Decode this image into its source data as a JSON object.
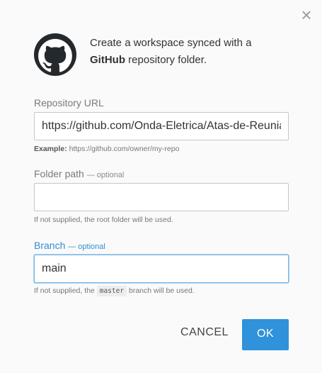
{
  "dialog": {
    "close_glyph": "×",
    "header": {
      "line1": "Create a workspace synced with a",
      "brand": "GitHub",
      "line2_rest": " repository folder.",
      "logo_icon": "github-icon"
    },
    "repo_url": {
      "label": "Repository URL",
      "value": "https://github.com/Onda-Eletrica/Atas-de-Reuniao",
      "hint_label": "Example:",
      "hint_text": " https://github.com/owner/my-repo"
    },
    "folder_path": {
      "label": "Folder path",
      "optional": "— optional",
      "value": "",
      "hint": "If not supplied, the root folder will be used."
    },
    "branch": {
      "label": "Branch",
      "optional": "— optional",
      "value": "main",
      "hint_prefix": "If not supplied, the ",
      "hint_code": "master",
      "hint_suffix": " branch will be used."
    },
    "buttons": {
      "cancel": "CANCEL",
      "ok": "OK"
    }
  },
  "colors": {
    "accent": "#2f92da",
    "focus_border": "#79b7e5",
    "label": "#7a7a7a",
    "active_label": "#2f8fd3"
  }
}
